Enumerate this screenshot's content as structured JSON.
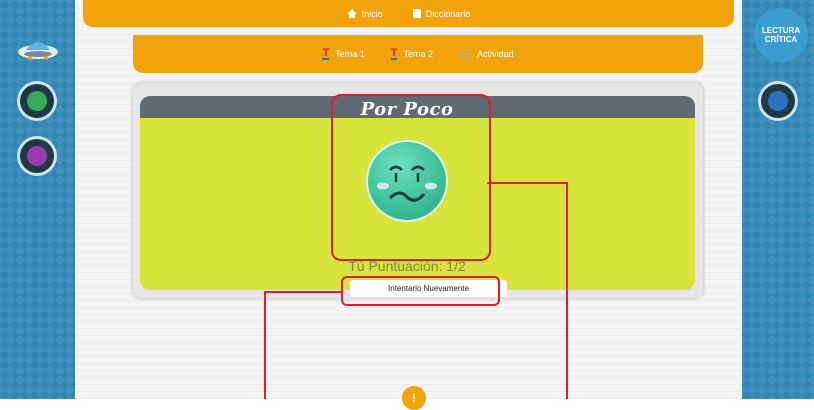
{
  "topbar": {
    "home_label": "Inicio",
    "dictionary_label": "Diccionario"
  },
  "tabs": [
    {
      "label": "Tema 1"
    },
    {
      "label": "Tema 2"
    },
    {
      "label": "Actividad"
    }
  ],
  "card": {
    "title": "Por Poco",
    "score_text": "Tú Puntuación: 1/2",
    "retry_label": "Intentarlo Nuevamente"
  },
  "right_rail": {
    "badge_line1": "LECTURA",
    "badge_line2": "CRÍTICA"
  },
  "help": {
    "label": "!"
  },
  "colors": {
    "accent_orange": "#f2a20a",
    "rail_blue": "#2f86b4",
    "card_lime": "#d8e43c",
    "highlight_red": "#e01f2a",
    "face_teal": "#3ec19b"
  },
  "icons": [
    "home-icon",
    "dictionary-icon",
    "tema-icon",
    "activity-icon",
    "sad-face-icon",
    "ufo-icon"
  ]
}
